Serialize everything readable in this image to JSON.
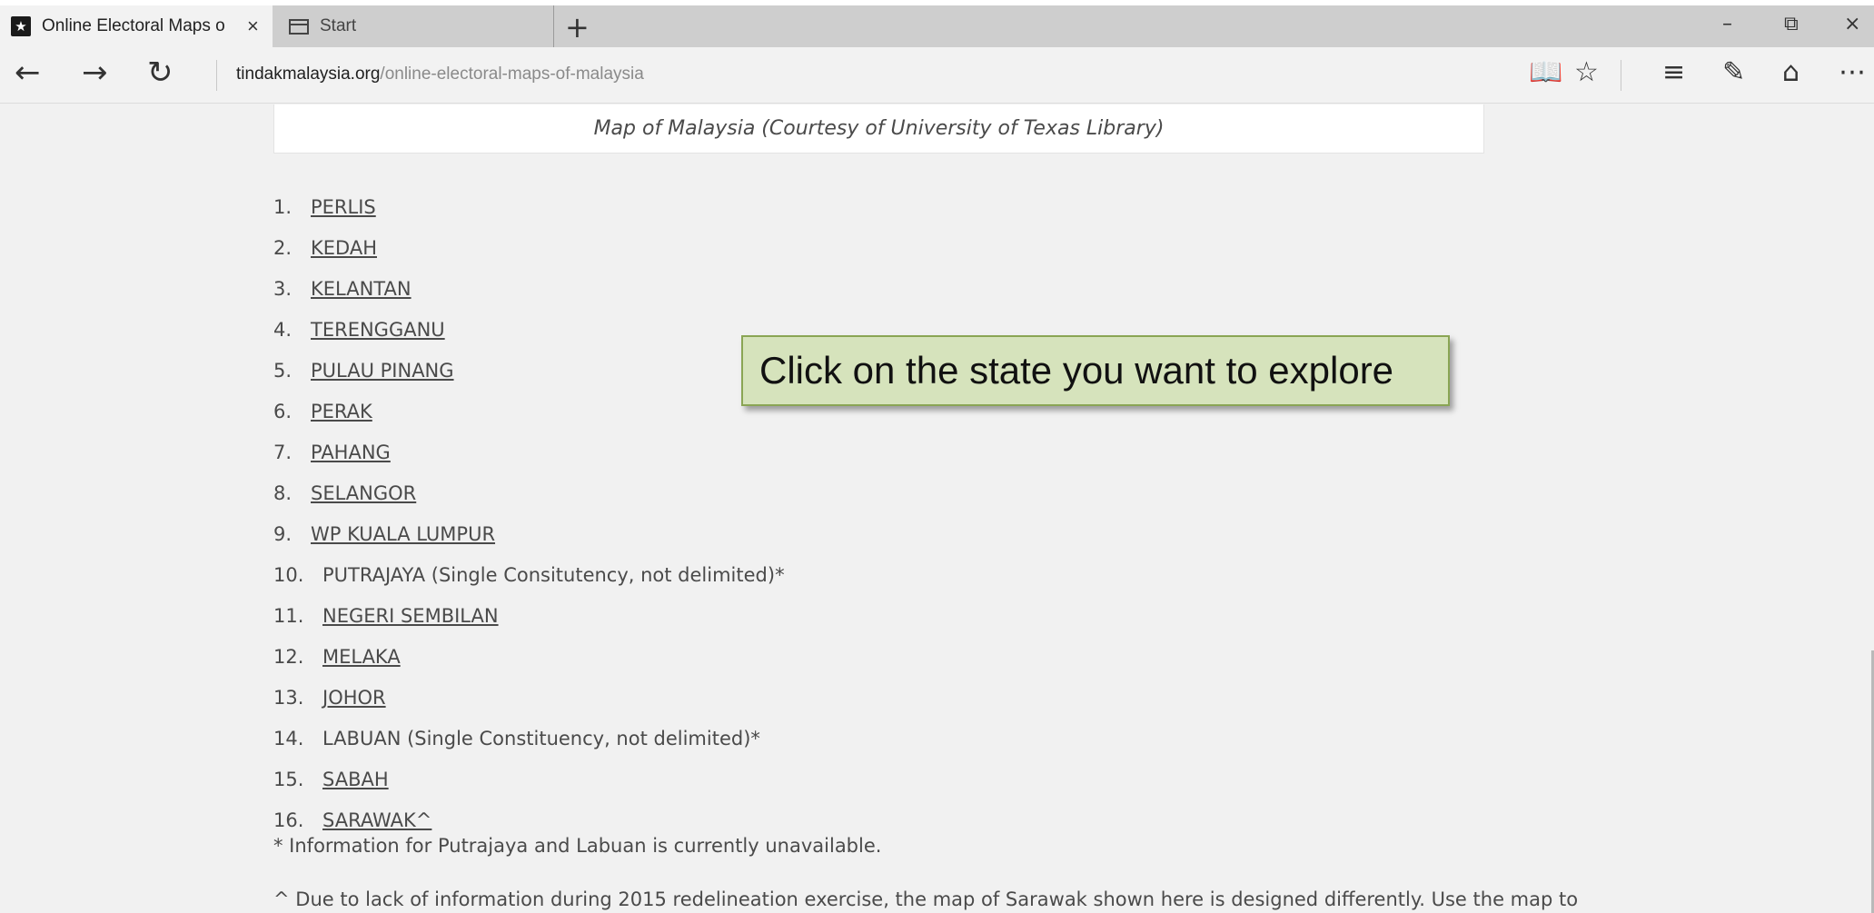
{
  "browser": {
    "tabs": [
      {
        "title": "Online Electoral Maps o",
        "favicon": "star-icon",
        "close": "×"
      },
      {
        "title": "Start",
        "favicon": "page-icon"
      }
    ],
    "new_tab": "+",
    "window_controls": {
      "minimize": "–",
      "restore": "⧉",
      "close": "×"
    },
    "nav": {
      "back": "←",
      "forward": "→",
      "refresh": "↻"
    },
    "address": {
      "domain": "tindakmalaysia.org",
      "path": "/online-electoral-maps-of-malaysia"
    },
    "toolbar": {
      "reading_view": "📖",
      "favorites": "☆",
      "hub": "≡",
      "notes": "✎",
      "share": "⌂",
      "more": "⋯"
    }
  },
  "page": {
    "map_caption": "Map of Malaysia (Courtesy of University of Texas Library)",
    "states": [
      {
        "num": "1.",
        "label": "PERLIS",
        "link": true
      },
      {
        "num": "2.",
        "label": "KEDAH",
        "link": true
      },
      {
        "num": "3.",
        "label": "KELANTAN",
        "link": true
      },
      {
        "num": "4.",
        "label": "TERENGGANU",
        "link": true
      },
      {
        "num": "5.",
        "label": "PULAU PINANG",
        "link": true
      },
      {
        "num": "6.",
        "label": "PERAK",
        "link": true
      },
      {
        "num": "7.",
        "label": "PAHANG",
        "link": true
      },
      {
        "num": "8.",
        "label": "SELANGOR",
        "link": true
      },
      {
        "num": "9.",
        "label": "WP KUALA LUMPUR",
        "link": true
      },
      {
        "num": "10.",
        "label": "PUTRAJAYA (Single Consitutency, not delimited)*",
        "link": false
      },
      {
        "num": "11.",
        "label": "NEGERI SEMBILAN",
        "link": true
      },
      {
        "num": "12.",
        "label": "MELAKA",
        "link": true
      },
      {
        "num": "13.",
        "label": "JOHOR",
        "link": true
      },
      {
        "num": "14.",
        "label": "LABUAN (Single Constituency, not delimited)*",
        "link": false
      },
      {
        "num": "15.",
        "label": "SABAH",
        "link": true
      },
      {
        "num": "16.",
        "label": "SARAWAK^",
        "link": true
      }
    ],
    "footnote_star": "* Information for Putrajaya and Labuan is currently unavailable.",
    "footnote_caret": "^ Due to lack of information during 2015 redelineation exercise, the map of Sarawak shown here is designed differently. Use the map to",
    "callout": "Click on the state you want to explore"
  },
  "colors": {
    "callout_bg": "#d6e3bc",
    "callout_border": "#8aa554",
    "page_bg": "#f1f1f1",
    "text": "#4a4a4a"
  }
}
